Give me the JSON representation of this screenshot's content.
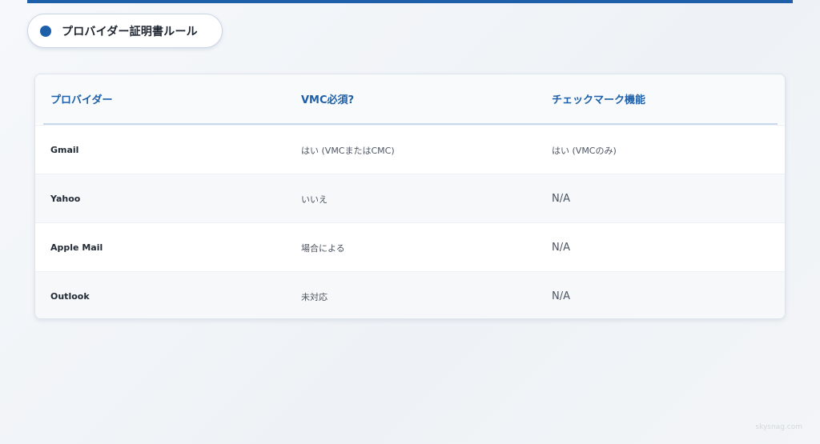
{
  "title": "プロバイダー証明書ルール",
  "colors": {
    "accent": "#1d5fa8",
    "text": "#222a35",
    "muted": "#4c5562"
  },
  "table": {
    "headers": [
      "プロバイダー",
      "VMC必須?",
      "チェックマーク機能"
    ],
    "rows": [
      {
        "provider": "Gmail",
        "vmc_required": "はい (VMCまたはCMC)",
        "checkmark": "はい (VMCのみ)"
      },
      {
        "provider": "Yahoo",
        "vmc_required": "いいえ",
        "checkmark": "N/A"
      },
      {
        "provider": "Apple Mail",
        "vmc_required": "場合による",
        "checkmark": "N/A"
      },
      {
        "provider": "Outlook",
        "vmc_required": "未対応",
        "checkmark": "N/A"
      }
    ]
  },
  "watermark": "skysnag.com"
}
